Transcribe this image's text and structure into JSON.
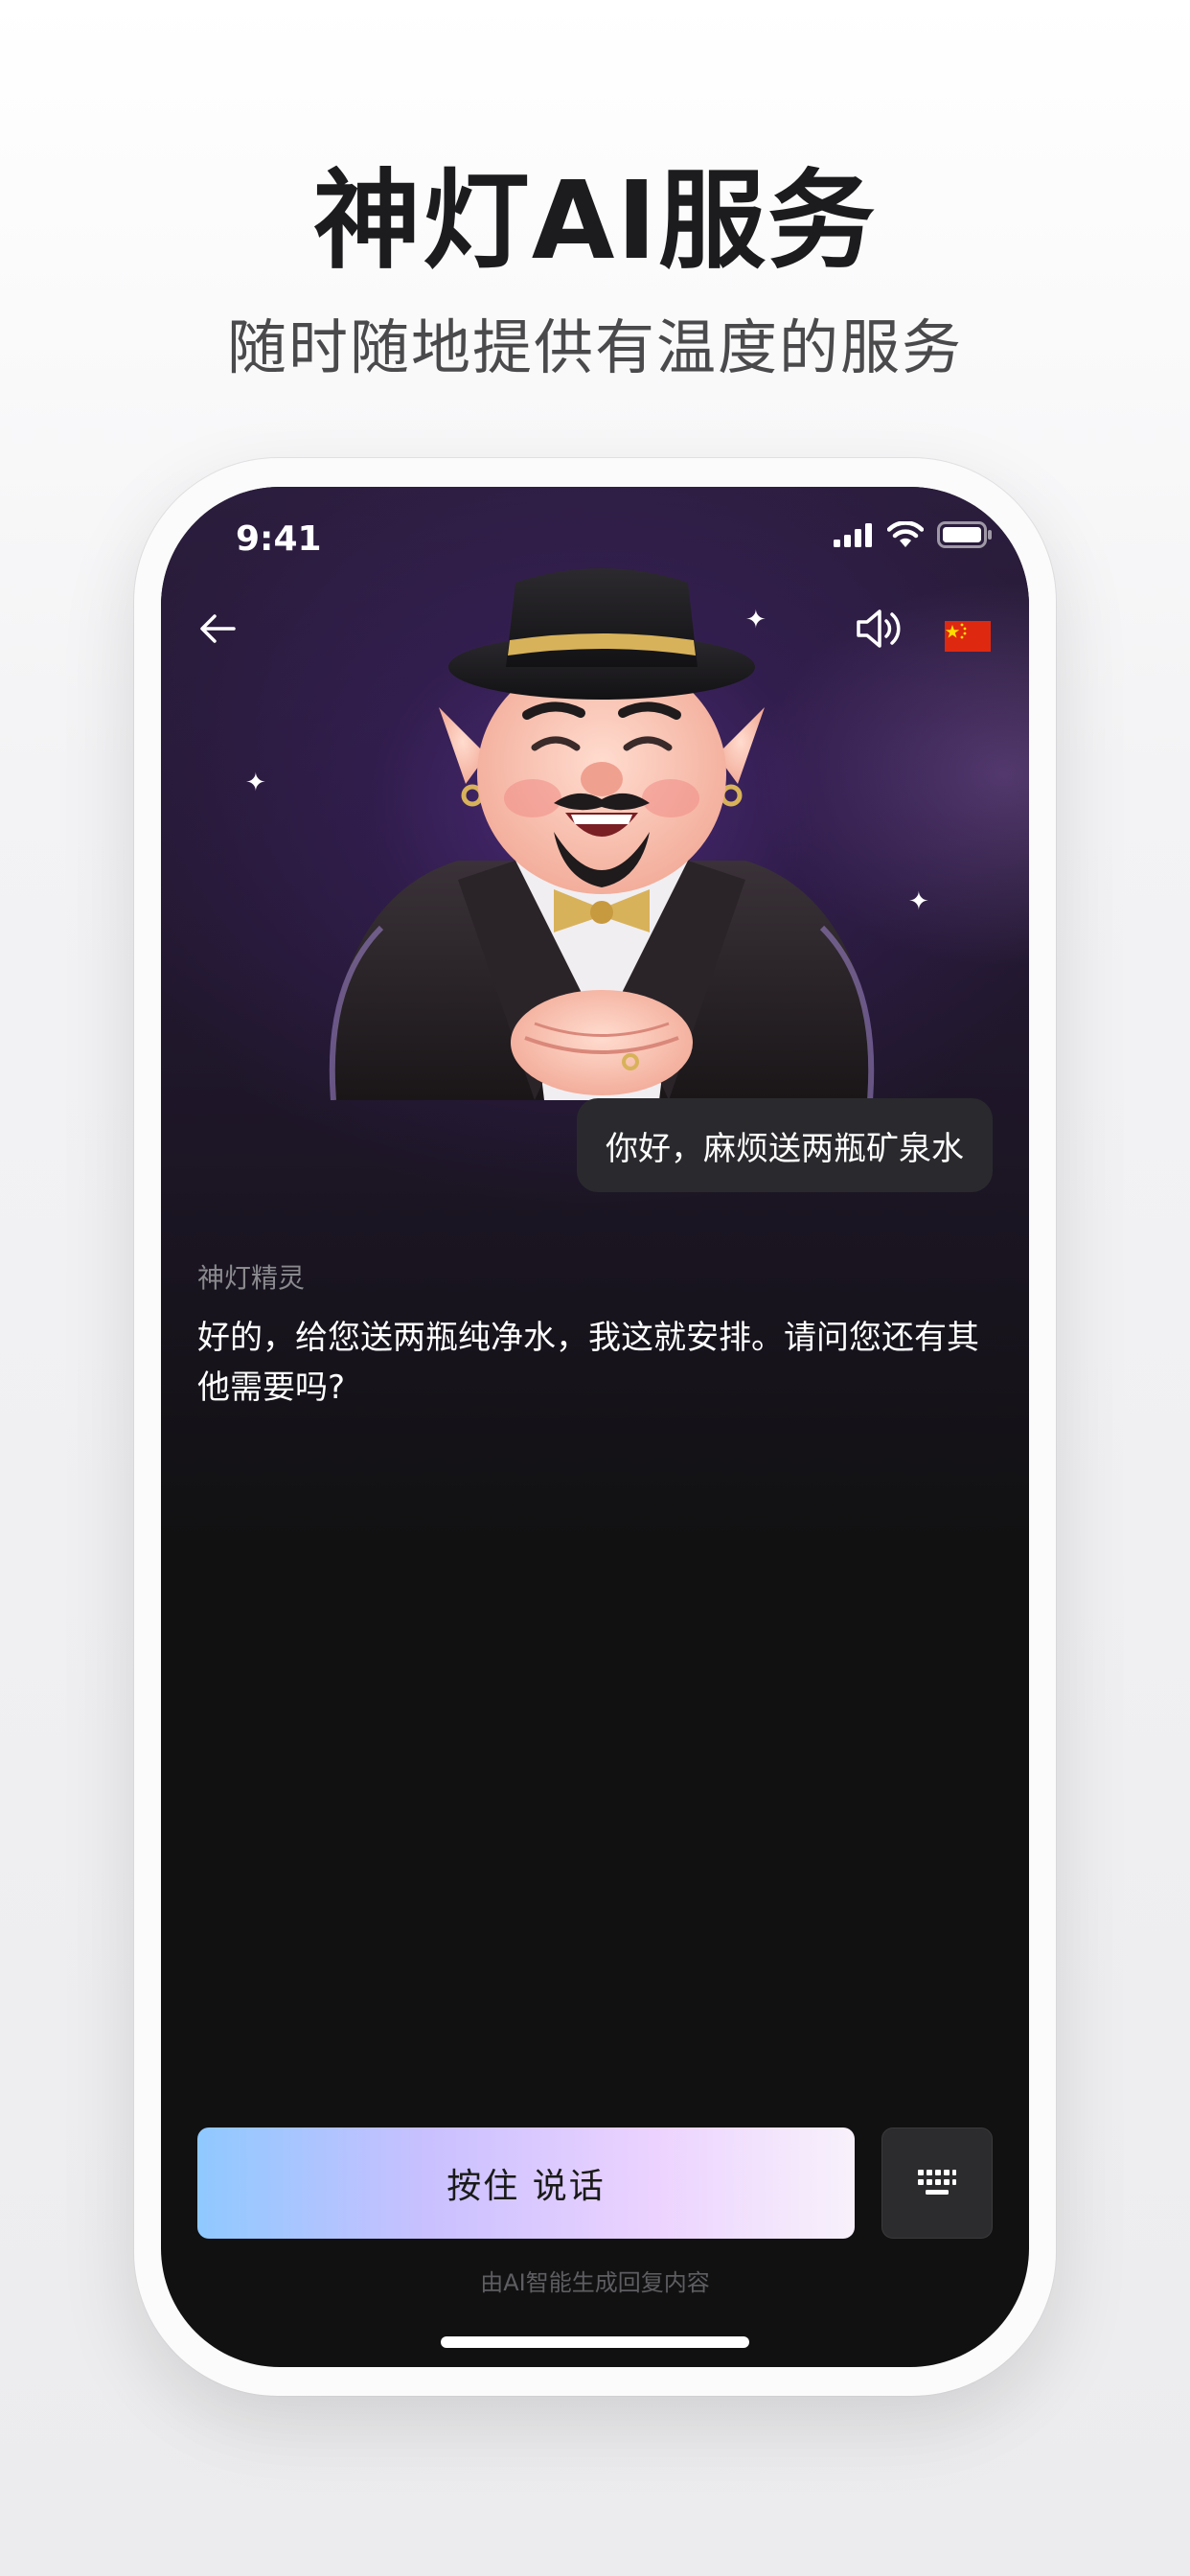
{
  "hero": {
    "title": "神灯AI服务",
    "subtitle": "随时随地提供有温度的服务"
  },
  "status_bar": {
    "time": "9:41",
    "icons": [
      "signal-icon",
      "wifi-icon",
      "battery-icon"
    ]
  },
  "nav": {
    "back_icon": "back-arrow-icon",
    "speaker_icon": "speaker-icon",
    "flag_icon": "china-flag-icon"
  },
  "chat": {
    "user_message": "你好，麻烦送两瓶矿泉水",
    "bot_name": "神灯精灵",
    "bot_message": "好的，给您送两瓶纯净水，我这就安排。请问您还有其他需要吗?"
  },
  "input": {
    "talk_label": "按住 说话",
    "keyboard_icon": "keyboard-icon"
  },
  "footer": {
    "disclaimer": "由AI智能生成回复内容"
  },
  "colors": {
    "screen_bg": "#111112",
    "bubble_bg": "#2a2a2e",
    "accent_gradient_start": "#8fc9ff",
    "accent_gradient_end": "#f8f1fb",
    "flag_red": "#de2910"
  }
}
